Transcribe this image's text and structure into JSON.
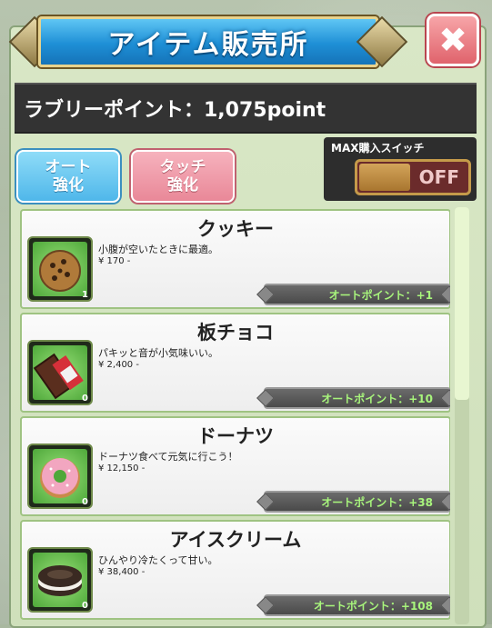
{
  "header": {
    "title": "アイテム販売所",
    "close_label": "✖"
  },
  "points": {
    "text": "ラブリーポイント：1,075point"
  },
  "modes": {
    "auto": {
      "line1": "オート",
      "line2": "強化"
    },
    "touch": {
      "line1": "タッチ",
      "line2": "強化"
    }
  },
  "max_switch": {
    "label": "MAX購入スイッチ",
    "state": "OFF"
  },
  "items": [
    {
      "name": "クッキー",
      "desc": "小腹が空いたときに最適。",
      "price": "¥ 170 -",
      "count": "1",
      "auto_points": "オートポイント：+1",
      "icon": "cookie-icon",
      "color": "#b07a3a"
    },
    {
      "name": "板チョコ",
      "desc": "パキッと音が小気味いい。",
      "price": "¥ 2,400 -",
      "count": "0",
      "auto_points": "オートポイント：+10",
      "icon": "chocolate-bar-icon",
      "color": "#5a2e1e"
    },
    {
      "name": "ドーナツ",
      "desc": "ドーナツ食べて元気に行こう！",
      "price": "¥ 12,150 -",
      "count": "0",
      "auto_points": "オートポイント：+38",
      "icon": "donut-icon",
      "color": "#f2a6c0"
    },
    {
      "name": "アイスクリーム",
      "desc": "ひんやり冷たくって甘い。",
      "price": "¥ 38,400 -",
      "count": "0",
      "auto_points": "オートポイント：+108",
      "icon": "ice-cream-sandwich-icon",
      "color": "#3a2a22"
    }
  ]
}
